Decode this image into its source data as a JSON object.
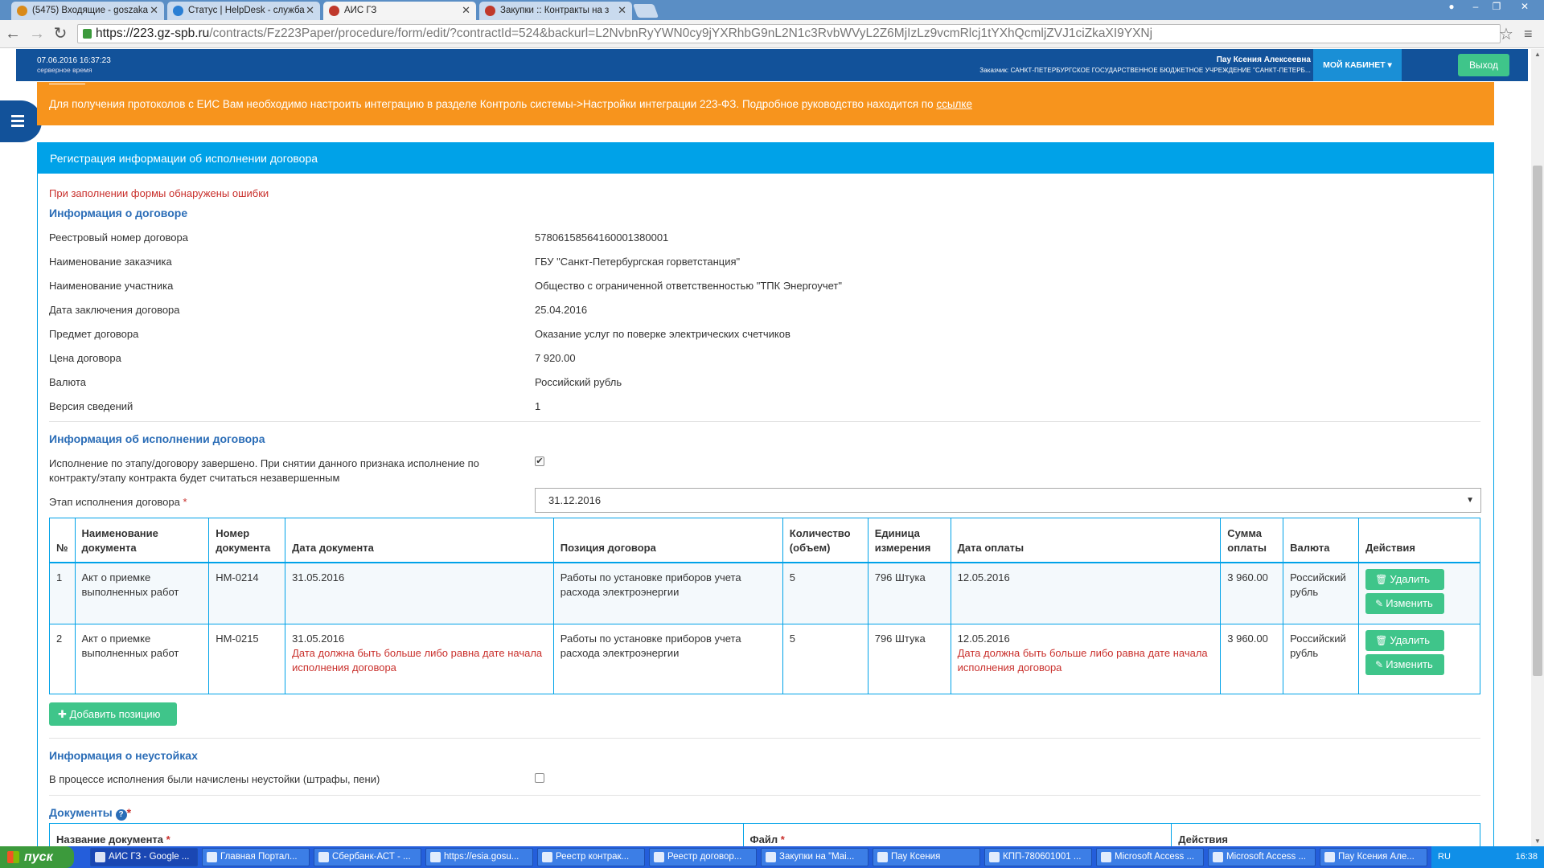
{
  "browser": {
    "tabs": [
      {
        "label": "(5475) Входящие - goszaka",
        "fav": "#d98a1a"
      },
      {
        "label": "Статус | HelpDesk - служба",
        "fav": "#2a7fd4"
      },
      {
        "label": "АИС ГЗ",
        "fav": "#c0392b"
      },
      {
        "label": "Закупки :: Контракты на з",
        "fav": "#c0392b"
      }
    ],
    "url_host": "https://223.gz-spb.ru",
    "url_path": "/contracts/Fz223Paper/procedure/form/edit/?contractId=524&backurl=L2NvbnRyYWN0cy9jYXRhbG9nL2N1c3RvbWVyL2Z6MjIzLz9vcmRlcj1tYXhQcmljZVJ1ciZkaXI9YXNj"
  },
  "header": {
    "datetime": "07.06.2016 16:37:23",
    "tz": "серверное время",
    "user": "Пау Ксения Алексеевна",
    "customer": "Заказчик: САНКТ-ПЕТЕРБУРГСКОЕ ГОСУДАРСТВЕННОЕ БЮДЖЕТНОЕ УЧРЕЖДЕНИЕ \"САНКТ-ПЕТЕРБ...",
    "cabinet": "МОЙ КАБИНЕТ",
    "logout": "Выход"
  },
  "alert": {
    "text": "Для получения протоколов с ЕИС Вам необходимо настроить интеграцию в разделе Контроль системы->Настройки интеграции 223-ФЗ. Подробное руководство находится по ",
    "link": "ссылке"
  },
  "panel": {
    "title": "Регистрация информации об исполнении договора",
    "form_error": "При заполнении формы обнаружены ошибки"
  },
  "contract_info": {
    "heading": "Информация о договоре",
    "rows": [
      {
        "label": "Реестровый номер договора",
        "value": "57806158564160001380001"
      },
      {
        "label": "Наименование заказчика",
        "value": "ГБУ \"Санкт-Петербургская горветстанция\""
      },
      {
        "label": "Наименование участника",
        "value": "Общество с ограниченной ответственностью \"ТПК Энергоучет\""
      },
      {
        "label": "Дата заключения договора",
        "value": "25.04.2016"
      },
      {
        "label": "Предмет договора",
        "value": "Оказание услуг по поверке электрических счетчиков"
      },
      {
        "label": "Цена договора",
        "value": "7 920.00"
      },
      {
        "label": "Валюта",
        "value": "Российский рубль"
      },
      {
        "label": "Версия сведений",
        "value": "1"
      }
    ]
  },
  "execution": {
    "heading": "Информация об исполнении договора",
    "completed_label_1": "Исполнение по этапу/договору завершено. При снятии данного признака исполнение по",
    "completed_label_2": "контракту/этапу контракта будет считаться незавершенным",
    "completed_checked": true,
    "stage_label": "Этап исполнения договора",
    "stage_required": "*",
    "stage_value": "31.12.2016",
    "columns": [
      "№",
      "Наименование документа",
      "Номер документа",
      "Дата документа",
      "Позиция договора",
      "Количество (объем)",
      "Единица измерения",
      "Дата оплаты",
      "Сумма оплаты",
      "Валюта",
      "Действия"
    ],
    "rows": [
      {
        "n": "1",
        "doc_name": "Акт о приемке выполненных работ",
        "doc_no": "НМ-0214",
        "doc_date": "31.05.2016",
        "doc_date_error": "",
        "position": "Работы по установке приборов учета расхода электроэнергии",
        "qty": "5",
        "unit": "796 Штука",
        "pay_date": "12.05.2016",
        "pay_date_error": "",
        "amount": "3 960.00",
        "currency": "Российский рубль"
      },
      {
        "n": "2",
        "doc_name": "Акт о приемке выполненных работ",
        "doc_no": "НМ-0215",
        "doc_date": "31.05.2016",
        "doc_date_error": "Дата должна быть больше либо равна дате начала исполнения договора",
        "position": "Работы по установке приборов учета расхода электроэнергии",
        "qty": "5",
        "unit": "796 Штука",
        "pay_date": "12.05.2016",
        "pay_date_error": "Дата должна быть больше либо равна дате начала исполнения договора",
        "amount": "3 960.00",
        "currency": "Российский рубль"
      }
    ],
    "delete_label": "Удалить",
    "edit_label": "Изменить",
    "add_label": "Добавить позицию"
  },
  "penalties": {
    "heading": "Информация о неустойках",
    "label": "В процессе исполнения были начислены неустойки (штрафы, пени)",
    "checked": false
  },
  "documents": {
    "heading": "Документы",
    "help": "?",
    "required": "*",
    "columns": [
      "Название документа",
      "Файл",
      "Действия"
    ],
    "col_required": "*"
  },
  "taskbar": {
    "start": "пуск",
    "items": [
      "АИС ГЗ - Google ...",
      "Главная Портал...",
      "Сбербанк-АСТ - ...",
      "https://esia.gosu...",
      "Реестр контрак...",
      "Реестр договор...",
      "Закупки на \"Mai...",
      "Пау Ксения",
      "КПП-780601001 ...",
      "Microsoft Access ...",
      "Microsoft Access ...",
      "Пау Ксения Але..."
    ],
    "lang": "RU",
    "clock": "16:38"
  }
}
